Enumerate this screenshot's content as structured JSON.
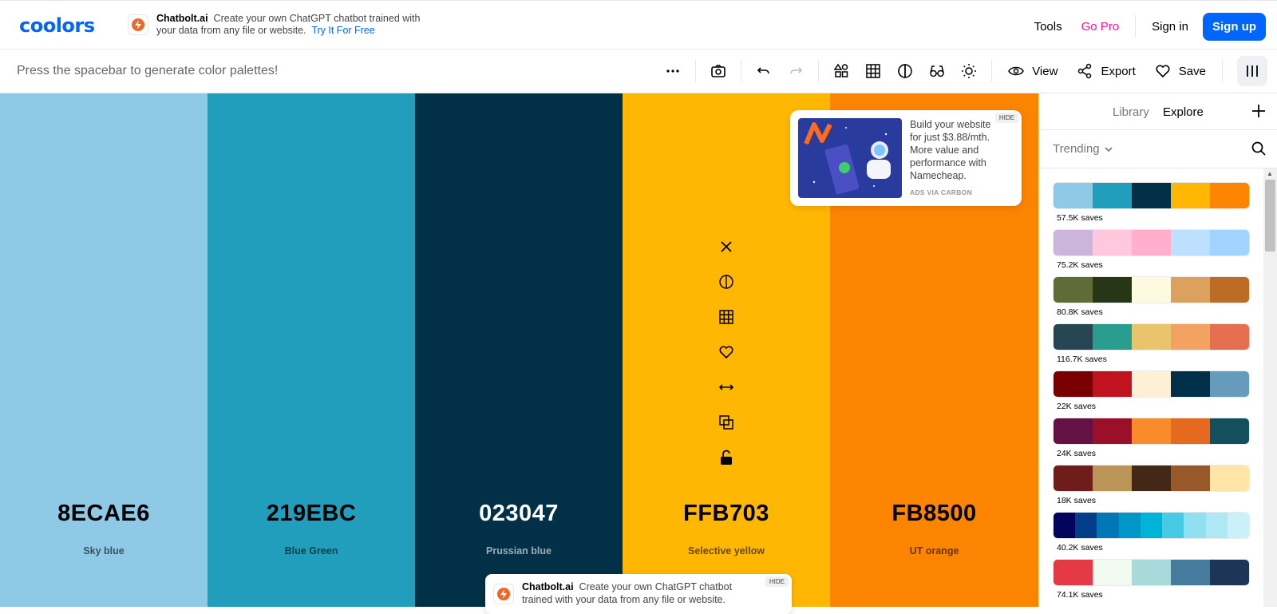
{
  "header": {
    "logo": "coolors",
    "promo": {
      "brand": "Chatbolt.ai",
      "text": "Create your own ChatGPT chatbot trained with your data from any file or website.",
      "cta": "Try It For Free"
    },
    "nav": {
      "tools": "Tools",
      "go_pro": "Go Pro",
      "sign_in": "Sign in",
      "sign_up": "Sign up"
    }
  },
  "toolbar": {
    "hint": "Press the spacebar to generate color palettes!",
    "view": "View",
    "export": "Export",
    "save": "Save",
    "icons": [
      "more-icon",
      "camera-icon",
      "undo-icon",
      "redo-icon",
      "shapes-icon",
      "grid-icon",
      "contrast-icon",
      "glasses-icon",
      "brightness-icon",
      "eye-icon",
      "share-icon",
      "heart-icon",
      "columns-icon"
    ]
  },
  "palette": [
    {
      "hex": "8ECAE6",
      "name": "Sky blue",
      "color": "#8ECAE6",
      "text_color": "#000000"
    },
    {
      "hex": "219EBC",
      "name": "Blue Green",
      "color": "#219EBC",
      "text_color": "#000000"
    },
    {
      "hex": "023047",
      "name": "Prussian blue",
      "color": "#023047",
      "text_color": "#FFFFFF"
    },
    {
      "hex": "FFB703",
      "name": "Selective yellow",
      "color": "#FFB703",
      "text_color": "#000000"
    },
    {
      "hex": "FB8500",
      "name": "UT orange",
      "color": "#FB8500",
      "text_color": "#000000"
    }
  ],
  "swatch_tools": [
    "close-icon",
    "contrast-icon",
    "grid-icon",
    "heart-icon",
    "drag-icon",
    "copy-icon",
    "unlock-icon"
  ],
  "ad": {
    "text": "Build your website for just $3.88/mth. More value and performance with Namecheap.",
    "via": "ADS VIA CARBON",
    "hide": "HIDE"
  },
  "bottom_ad": {
    "brand": "Chatbolt.ai",
    "text": "Create your own ChatGPT chatbot trained with your data from any file or website.",
    "hide": "HIDE"
  },
  "sidebar": {
    "tabs": {
      "library": "Library",
      "explore": "Explore"
    },
    "filter": "Trending",
    "palettes": [
      {
        "colors": [
          "#8ECAE6",
          "#219EBC",
          "#023047",
          "#FFB703",
          "#FB8500"
        ],
        "saves": "57.5K saves"
      },
      {
        "colors": [
          "#CDB4DB",
          "#FFC8DD",
          "#FFAFCC",
          "#BDE0FE",
          "#A2D2FF"
        ],
        "saves": "75.2K saves"
      },
      {
        "colors": [
          "#606C38",
          "#283618",
          "#FEFAE0",
          "#DDA15E",
          "#BC6C25"
        ],
        "saves": "80.8K saves"
      },
      {
        "colors": [
          "#264653",
          "#2A9D8F",
          "#E9C46A",
          "#F4A261",
          "#E76F51"
        ],
        "saves": "116.7K saves"
      },
      {
        "colors": [
          "#780000",
          "#C1121F",
          "#FDF0D5",
          "#003049",
          "#669BBC"
        ],
        "saves": "22K saves"
      },
      {
        "colors": [
          "#641144",
          "#9B0F28",
          "#F98B2A",
          "#E5691F",
          "#134F5C"
        ],
        "saves": "24K saves"
      },
      {
        "colors": [
          "#6F1D1B",
          "#BB9457",
          "#432818",
          "#99582A",
          "#FFE6A7"
        ],
        "saves": "18K saves"
      },
      {
        "colors": [
          "#03045E",
          "#023E8A",
          "#0077B6",
          "#0096C7",
          "#00B4D8",
          "#48CAE4",
          "#90E0EF",
          "#ADE8F4",
          "#CAF0F8"
        ],
        "saves": "40.2K saves"
      },
      {
        "colors": [
          "#E63946",
          "#F1FAEE",
          "#A8DADC",
          "#457B9D",
          "#1D3557"
        ],
        "saves": "74.1K saves"
      }
    ]
  }
}
